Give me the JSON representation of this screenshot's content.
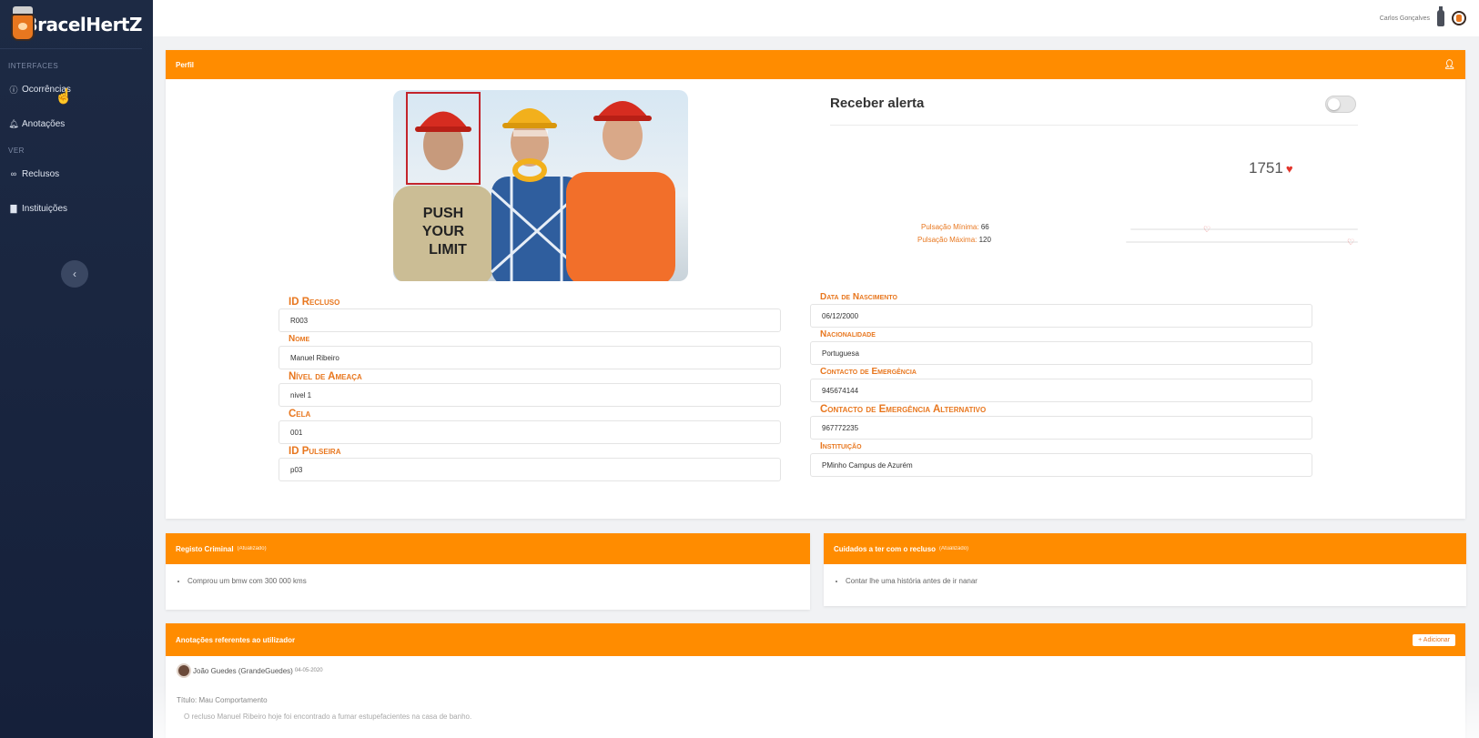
{
  "app": {
    "name": "BracelHertZ"
  },
  "user": {
    "name": "Carlos Gonçalves"
  },
  "sidebar": {
    "sections": [
      {
        "label": "Interfaces"
      },
      {
        "label": "Ver"
      }
    ],
    "items": [
      {
        "label": "Ocorrências",
        "icon": "info-circle-icon"
      },
      {
        "label": "Anotações",
        "icon": "bell-icon"
      },
      {
        "label": "Reclusos",
        "icon": "handcuffs-icon"
      },
      {
        "label": "Instituições",
        "icon": "bar-chart-icon"
      }
    ],
    "collapse_label": "‹"
  },
  "profile": {
    "header": "Perfil",
    "alert_label": "Receber alerta",
    "alert_enabled": false,
    "bpm": "1751",
    "pulse_min_label": "Pulsação Mínima:",
    "pulse_min_value": "66",
    "pulse_max_label": "Pulsação Máxima:",
    "pulse_max_value": "120",
    "fields_left": [
      {
        "label": "ID Recluso",
        "value": "R003"
      },
      {
        "label": "Nome",
        "value": "Manuel Ribeiro"
      },
      {
        "label": "Nível de Ameaça",
        "value": "nivel 1"
      },
      {
        "label": "Cela",
        "value": "001"
      },
      {
        "label": "ID Pulseira",
        "value": "p03"
      }
    ],
    "fields_right": [
      {
        "label": "Data de Nascimento",
        "value": "06/12/2000"
      },
      {
        "label": "Nacionalidade",
        "value": "Portuguesa"
      },
      {
        "label": "Contacto de Emergência",
        "value": "945674144"
      },
      {
        "label": "Contacto de Emergência Alternativo",
        "value": "967772235"
      },
      {
        "label": "Instituição",
        "value": "PMinho Campus de Azurém"
      }
    ]
  },
  "criminal": {
    "header": "Registo Criminal",
    "header_note": "(Atualizado)",
    "items": [
      "Comprou um bmw com 300 000 kms"
    ]
  },
  "care": {
    "header": "Cuidados a ter com o recluso",
    "header_note": "(Atualizado)",
    "items": [
      "Contar lhe uma história antes de ir nanar"
    ]
  },
  "notes": {
    "header": "Anotações referentes ao utilizador",
    "add_label": "+ Adicionar",
    "author": "João Guedes (GrandeGuedes)",
    "date": "04-05-2020",
    "title": "Título: Mau Comportamento",
    "body": "O recluso Manuel Ribeiro hoje foi encontrado a fumar estupefacientes na casa de banho."
  },
  "colors": {
    "accent": "#ff8c00",
    "sidebar": "#1d2a44"
  }
}
